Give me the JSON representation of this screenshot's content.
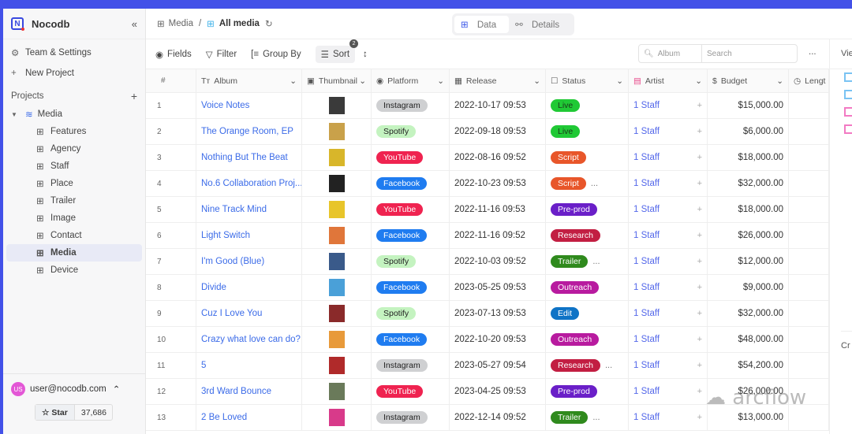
{
  "app": {
    "name": "Nocodb",
    "collapse_icon": "chevrons-left-icon"
  },
  "sidebar": {
    "team": "Team & Settings",
    "new_project": "New Project",
    "projects_label": "Projects",
    "project": "Media",
    "tables": [
      "Features",
      "Agency",
      "Staff",
      "Place",
      "Trailer",
      "Image",
      "Contact",
      "Media",
      "Device"
    ],
    "active": "Media"
  },
  "user": {
    "initials": "US",
    "email": "user@nocodb.com",
    "star_label": "Star",
    "star_count": "37,686"
  },
  "breadcrumb": {
    "table": "Media",
    "separator": "/",
    "view": "All media"
  },
  "tabs": {
    "data": "Data",
    "details": "Details"
  },
  "toolbar": {
    "fields": "Fields",
    "filter": "Filter",
    "group_by": "Group By",
    "sort": "Sort",
    "sort_count": "2",
    "search_field": "Album",
    "search_placeholder": "Search",
    "more": "..."
  },
  "columns": [
    "#",
    "Album",
    "Thumbnail",
    "Platform",
    "Release",
    "Status",
    "Artist",
    "Budget",
    "Lengt"
  ],
  "rows": [
    {
      "n": "1",
      "album": "Voice Notes",
      "platform": "Instagram",
      "release": "2022-10-17 09:53",
      "status": "Live",
      "more": "",
      "artist": "1 Staff",
      "budget": "$15,000.00",
      "thumb": "#3a3a3a"
    },
    {
      "n": "2",
      "album": "The Orange Room, EP",
      "platform": "Spotify",
      "release": "2022-09-18 09:53",
      "status": "Live",
      "more": "",
      "artist": "1 Staff",
      "budget": "$6,000.00",
      "thumb": "#c9a14a"
    },
    {
      "n": "3",
      "album": "Nothing But The Beat",
      "platform": "YouTube",
      "release": "2022-08-16 09:52",
      "status": "Script",
      "more": "",
      "artist": "1 Staff",
      "budget": "$18,000.00",
      "thumb": "#d8b62a"
    },
    {
      "n": "4",
      "album": "No.6 Collaboration Proj...",
      "platform": "Facebook",
      "release": "2022-10-23 09:53",
      "status": "Script",
      "more": "...",
      "artist": "1 Staff",
      "budget": "$32,000.00",
      "thumb": "#222"
    },
    {
      "n": "5",
      "album": "Nine Track Mind",
      "platform": "YouTube",
      "release": "2022-11-16 09:53",
      "status": "Pre-prod",
      "more": "",
      "artist": "1 Staff",
      "budget": "$18,000.00",
      "thumb": "#e8c52a"
    },
    {
      "n": "6",
      "album": "Light Switch",
      "platform": "Facebook",
      "release": "2022-11-16 09:52",
      "status": "Research",
      "more": "",
      "artist": "1 Staff",
      "budget": "$26,000.00",
      "thumb": "#e0763a"
    },
    {
      "n": "7",
      "album": "I'm Good (Blue)",
      "platform": "Spotify",
      "release": "2022-10-03 09:52",
      "status": "Trailer",
      "more": "...",
      "artist": "1 Staff",
      "budget": "$12,000.00",
      "thumb": "#3a5a8a"
    },
    {
      "n": "8",
      "album": "Divide",
      "platform": "Facebook",
      "release": "2023-05-25 09:53",
      "status": "Outreach",
      "more": "",
      "artist": "1 Staff",
      "budget": "$9,000.00",
      "thumb": "#4aa0d8"
    },
    {
      "n": "9",
      "album": "Cuz I Love You",
      "platform": "Spotify",
      "release": "2023-07-13 09:53",
      "status": "Edit",
      "more": "",
      "artist": "1 Staff",
      "budget": "$32,000.00",
      "thumb": "#8a2a2a"
    },
    {
      "n": "10",
      "album": "Crazy what love can do?",
      "platform": "Facebook",
      "release": "2022-10-20 09:53",
      "status": "Outreach",
      "more": "",
      "artist": "1 Staff",
      "budget": "$48,000.00",
      "thumb": "#e89a3a"
    },
    {
      "n": "11",
      "album": "5",
      "platform": "Instagram",
      "release": "2023-05-27 09:54",
      "status": "Research",
      "more": "...",
      "artist": "1 Staff",
      "budget": "$54,200.00",
      "thumb": "#b02a2a"
    },
    {
      "n": "12",
      "album": "3rd Ward Bounce",
      "platform": "YouTube",
      "release": "2023-04-25 09:53",
      "status": "Pre-prod",
      "more": "",
      "artist": "1 Staff",
      "budget": "$26,000.00",
      "thumb": "#6a7a5a"
    },
    {
      "n": "13",
      "album": "2 Be Loved",
      "platform": "Instagram",
      "release": "2022-12-14 09:52",
      "status": "Trailer",
      "more": "...",
      "artist": "1 Staff",
      "budget": "$13,000.00",
      "thumb": "#d83a8a"
    }
  ],
  "platform_colors": {
    "Instagram": [
      "#cfd0d2",
      "#222"
    ],
    "Spotify": [
      "#c4f3c0",
      "#222"
    ],
    "YouTube": [
      "#ef2350",
      "#fff"
    ],
    "Facebook": [
      "#1f7cf0",
      "#fff"
    ]
  },
  "status_colors": {
    "Live": [
      "#20c935",
      "#1a3a1a"
    ],
    "Script": [
      "#e8562a",
      "#fff"
    ],
    "Pre-prod": [
      "#6a1fc8",
      "#fff"
    ],
    "Research": [
      "#c21e42",
      "#fff"
    ],
    "Trailer": [
      "#2f8a1d",
      "#fff"
    ],
    "Outreach": [
      "#b81b9f",
      "#fff"
    ],
    "Edit": [
      "#0f73c6",
      "#fff"
    ]
  },
  "right_panel": {
    "label": "Vie",
    "label2": "Cr"
  },
  "watermark": "arcflow"
}
